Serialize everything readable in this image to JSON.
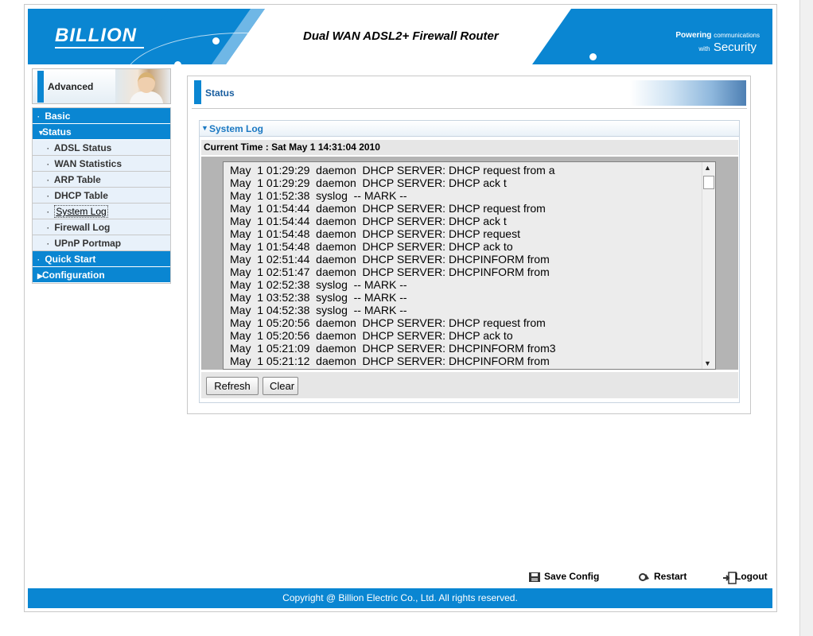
{
  "header": {
    "logo": "BILLION",
    "title": "Dual WAN ADSL2+ Firewall Router",
    "tagline_line1_bold": "Powering",
    "tagline_line1_small": "communications",
    "tagline_line2_small": "with",
    "tagline_line2_big": "Security"
  },
  "sidebar": {
    "mode_label": "Advanced",
    "menu": [
      {
        "label": "Basic",
        "expanded": false
      },
      {
        "label": "Status",
        "expanded": true
      }
    ],
    "status_items": [
      "ADSL Status",
      "WAN Statistics",
      "ARP Table",
      "DHCP Table",
      "System Log",
      "Firewall Log",
      "UPnP Portmap"
    ],
    "active_item": "System Log",
    "menu_after": [
      {
        "label": "Quick Start",
        "expanded": false
      },
      {
        "label": "Configuration",
        "expanded": false
      }
    ]
  },
  "main": {
    "section_title": "Status",
    "panel_title": "System Log",
    "current_time": "Current Time : Sat May 1 14:31:04 2010",
    "log_lines": [
      "May  1 01:29:29  daemon  DHCP SERVER: DHCP request from a",
      "May  1 01:29:29  daemon  DHCP SERVER: DHCP ack t",
      "May  1 01:52:38  syslog  -- MARK --",
      "May  1 01:54:44  daemon  DHCP SERVER: DHCP request from",
      "May  1 01:54:44  daemon  DHCP SERVER: DHCP ack t",
      "May  1 01:54:48  daemon  DHCP SERVER: DHCP request",
      "May  1 01:54:48  daemon  DHCP SERVER: DHCP ack to",
      "May  1 02:51:44  daemon  DHCP SERVER: DHCPINFORM from",
      "May  1 02:51:47  daemon  DHCP SERVER: DHCPINFORM from",
      "May  1 02:52:38  syslog  -- MARK --",
      "May  1 03:52:38  syslog  -- MARK --",
      "May  1 04:52:38  syslog  -- MARK --",
      "May  1 05:20:56  daemon  DHCP SERVER: DHCP request from",
      "May  1 05:20:56  daemon  DHCP SERVER: DHCP ack to",
      "May  1 05:21:09  daemon  DHCP SERVER: DHCPINFORM from3",
      "May  1 05:21:12  daemon  DHCP SERVER: DHCPINFORM from"
    ],
    "buttons": {
      "refresh": "Refresh",
      "clear": "Clear"
    }
  },
  "footer": {
    "save_config": "Save Config",
    "restart": "Restart",
    "logout": "Logout",
    "copyright": "Copyright @ Billion Electric Co., Ltd. All rights reserved."
  },
  "colors": {
    "brand_blue": "#0a86d2",
    "title_blue": "#1a5fa0"
  }
}
